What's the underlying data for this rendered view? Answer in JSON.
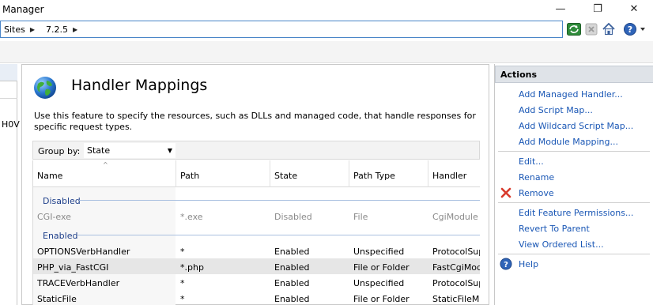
{
  "window": {
    "title": "Manager",
    "minimize_glyph": "—",
    "maximize_glyph": "❐",
    "close_glyph": "✕"
  },
  "address": {
    "segments": [
      "Sites",
      "7.2.5"
    ],
    "icons": [
      "refresh-icon",
      "stop-icon",
      "home-icon",
      "help-icon"
    ]
  },
  "left_pane": {
    "partial_text": "H0V"
  },
  "feature": {
    "title": "Handler Mappings",
    "description": "Use this feature to specify the resources, such as DLLs and managed code, that handle responses for specific request types.",
    "icon": "globe-icon"
  },
  "filter": {
    "group_by_label": "Group by:",
    "group_by_value": "State"
  },
  "table": {
    "columns": [
      "Name",
      "Path",
      "State",
      "Path Type",
      "Handler"
    ],
    "groups": [
      {
        "label": "Disabled",
        "rows": [
          {
            "name": "CGI-exe",
            "path": "*.exe",
            "state": "Disabled",
            "path_type": "File",
            "handler": "CgiModule"
          }
        ]
      },
      {
        "label": "Enabled",
        "rows": [
          {
            "name": "OPTIONSVerbHandler",
            "path": "*",
            "state": "Enabled",
            "path_type": "Unspecified",
            "handler": "ProtocolSupportModule"
          },
          {
            "name": "PHP_via_FastCGI",
            "path": "*.php",
            "state": "Enabled",
            "path_type": "File or Folder",
            "handler": "FastCgiModule",
            "selected": true
          },
          {
            "name": "TRACEVerbHandler",
            "path": "*",
            "state": "Enabled",
            "path_type": "Unspecified",
            "handler": "ProtocolSupportModule"
          },
          {
            "name": "StaticFile",
            "path": "*",
            "state": "Enabled",
            "path_type": "File or Folder",
            "handler": "StaticFileModule"
          }
        ]
      }
    ]
  },
  "actions": {
    "header": "Actions",
    "group1": [
      "Add Managed Handler...",
      "Add Script Map...",
      "Add Wildcard Script Map...",
      "Add Module Mapping..."
    ],
    "group2": [
      "Edit...",
      "Rename",
      "Remove"
    ],
    "group3": [
      "Edit Feature Permissions...",
      "Revert To Parent",
      "View Ordered List..."
    ],
    "group4": [
      "Help"
    ]
  },
  "colors": {
    "link": "#1a57b5",
    "group_header": "#1e3f8a",
    "selected_row": "#e6e6e6",
    "remove_icon": "#d83a2c"
  }
}
